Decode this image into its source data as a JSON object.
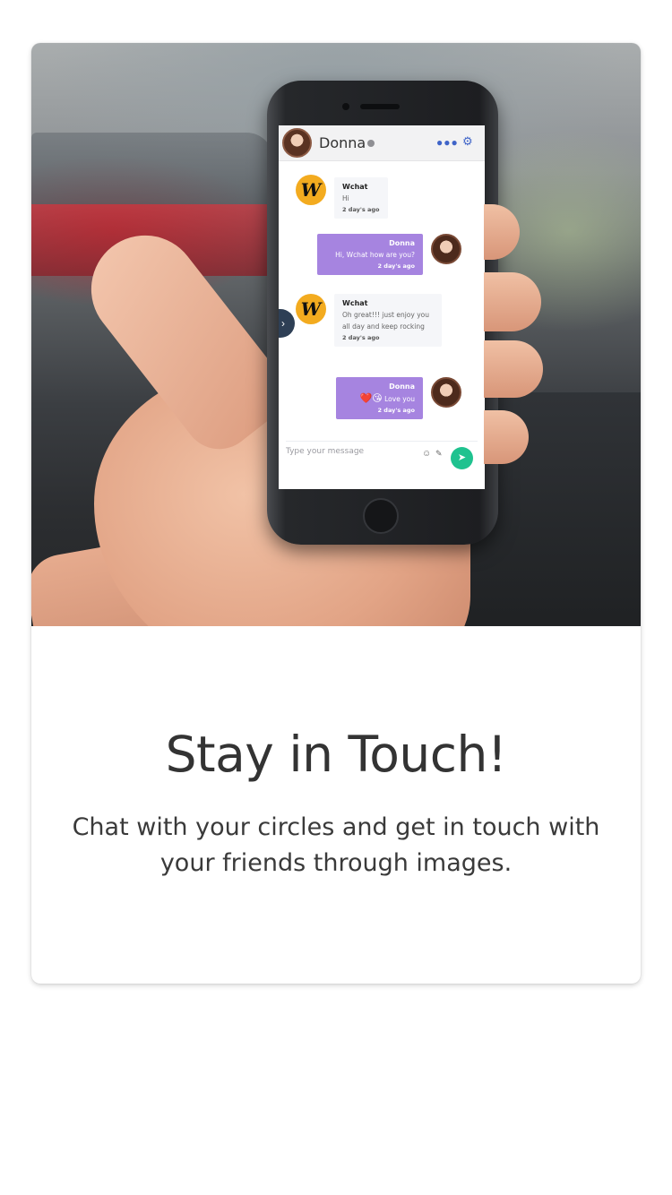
{
  "chat": {
    "contact_name": "Donna",
    "messages": [
      {
        "sender": "Wchat",
        "text": "Hi",
        "time": "2 day's ago"
      },
      {
        "sender": "Donna",
        "text": "Hi, Wchat how are you?",
        "time": "2 day's ago"
      },
      {
        "sender": "Wchat",
        "text": "Oh great!!! just enjoy you all day and keep rocking",
        "time": "2 day's ago"
      },
      {
        "sender": "Donna",
        "text": "Love you",
        "emoji": "❤️😘",
        "time": "2 day's ago"
      }
    ],
    "input_placeholder": "Type your message",
    "brand_letter": "W",
    "colors": {
      "outgoing": "#a684e0",
      "send": "#1fc28f",
      "brand": "#f3ab1f"
    }
  },
  "onboarding": {
    "title": "Stay in Touch!",
    "subtitle": "Chat with your circles and get in touch with your friends through images."
  }
}
